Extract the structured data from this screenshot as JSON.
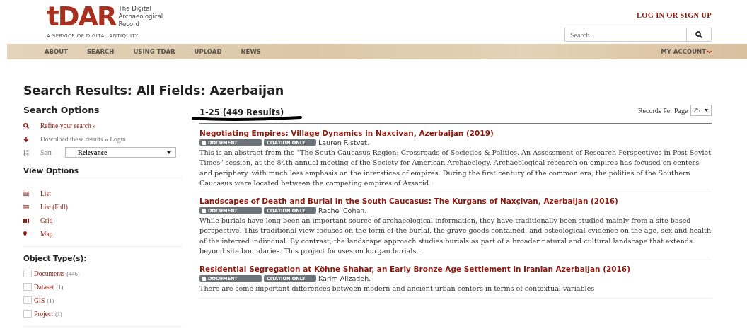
{
  "logo": {
    "mark": "tDAR",
    "name_lines": [
      "The Digital",
      "Archaeological",
      "Record"
    ],
    "tagline": "A SERVICE OF DIGITAL ANTIQUITY"
  },
  "auth_link": "LOG IN OR SIGN UP",
  "search": {
    "placeholder": "Search..."
  },
  "nav": {
    "items": [
      "ABOUT",
      "SEARCH",
      "USING TDAR",
      "UPLOAD",
      "NEWS"
    ],
    "account": "MY ACCOUNT"
  },
  "page_title": "Search Results: All Fields: Azerbaijan",
  "sidebar": {
    "search_options_title": "Search Options",
    "refine": "Refine your search »",
    "download": "Download these results » Login",
    "sort_label": "Sort",
    "sort_value": "Relevance",
    "view_options_title": "View Options",
    "views": [
      {
        "kind": "list",
        "label": "List"
      },
      {
        "kind": "list",
        "label": "List (Full)"
      },
      {
        "kind": "grid",
        "label": "Grid"
      },
      {
        "kind": "map",
        "label": "Map"
      }
    ],
    "object_types_title": "Object Type(s):",
    "object_types": [
      {
        "label": "Documents",
        "count": "(446)",
        "checked": false
      },
      {
        "label": "Dataset",
        "count": "(1)",
        "checked": false
      },
      {
        "label": "GIS",
        "count": "(1)",
        "checked": false
      },
      {
        "label": "Project",
        "count": "(1)",
        "checked": false
      }
    ]
  },
  "results_header": {
    "range": "1-25 (449 Results)",
    "per_page_label": "Records Per Page",
    "per_page_value": "25"
  },
  "results": [
    {
      "title": "Negotiating Empires: Village Dynamics in Naxcivan, Azerbaijan (2019)",
      "tags": [
        "DOCUMENT",
        "CITATION ONLY"
      ],
      "author": "Lauren Ristvet.",
      "abstract": "This is an abstract from the \"The South Caucasus Region: Crossroads of Societies & Polities. An Assessment of Research Perspectives in Post-Soviet Times\" session, at the 84th annual meeting of the Society for American Archaeology. Archaeological research on empires has focused on centers and periphery, with much less emphasis on the interstices of empires. During the first century of the common era, the polities of the Southern Caucasus were located between the competing empires of Arsacid..."
    },
    {
      "title": "Landscapes of Death and Burial in the South Caucasus: The Kurgans of Naxçivan, Azerbaijan (2016)",
      "tags": [
        "DOCUMENT",
        "CITATION ONLY"
      ],
      "author": "Rachel Cohen.",
      "abstract": "While burials have long been an important source of archaeological information, they have traditionally been studied mainly from a site-based perspective. This traditional view focuses on the form of the burial, the grave goods contained, and osteological evidence on the age, sex and health of the interred individual. By contrast, the landscape approach studies burials as part of a broader natural and cultural landscape that extends beyond site boundaries. This project focuses on kurgan burials..."
    },
    {
      "title": "Residential Segregation at Köhne Shahar, an Early Bronze Age Settlement in Iranian Azerbaijan (2016)",
      "tags": [
        "DOCUMENT",
        "CITATION ONLY"
      ],
      "author": "Karim Alizadeh.",
      "abstract": "There are some important differences between modern and ancient urban centers in terms of contextual variables"
    }
  ]
}
